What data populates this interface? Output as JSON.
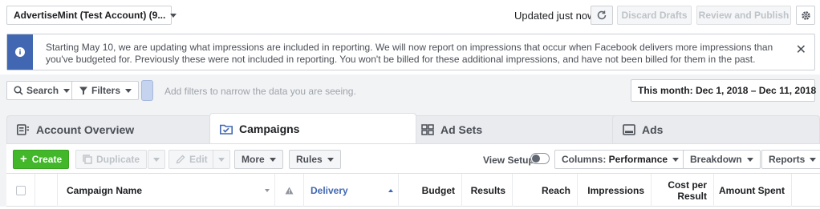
{
  "topbar": {
    "account_name": "AdvertiseMint (Test Account) (9...",
    "updated_status": "Updated just now",
    "discard_label": "Discard Drafts",
    "publish_label": "Review and Publish"
  },
  "banner": {
    "text": "Starting May 10, we are updating what impressions are included in reporting. We will now report on impressions that occur when Facebook delivers more impressions than you've budgeted for. Previously these were not included in reporting. You won't be billed for these additional impressions, and have not been billed for them in the past.",
    "close": "✕",
    "accent": "#4267b2"
  },
  "filters": {
    "search_label": "Search",
    "filters_label": "Filters",
    "placeholder": "Add filters to narrow the data you are seeing.",
    "date_range": "This month: Dec 1, 2018 – Dec 11, 2018"
  },
  "tabs": [
    {
      "label": "Account Overview",
      "icon": "account-overview-icon"
    },
    {
      "label": "Campaigns",
      "icon": "campaigns-folder-icon",
      "active": true
    },
    {
      "label": "Ad Sets",
      "icon": "ad-sets-grid-icon"
    },
    {
      "label": "Ads",
      "icon": "ads-icon"
    }
  ],
  "toolbar": {
    "create_label": "Create",
    "duplicate_label": "Duplicate",
    "edit_label": "Edit",
    "more_label": "More",
    "rules_label": "Rules",
    "view_setup_label": "View Setup",
    "columns_prefix": "Columns: ",
    "columns_value": "Performance",
    "breakdown_label": "Breakdown",
    "reports_label": "Reports",
    "create_color": "#42b72a"
  },
  "table": {
    "columns": {
      "name": "Campaign Name",
      "delivery": "Delivery",
      "budget": "Budget",
      "results": "Results",
      "reach": "Reach",
      "impressions": "Impressions",
      "cost_per_result": "Cost per Result",
      "amount_spent": "Amount Spent"
    }
  }
}
